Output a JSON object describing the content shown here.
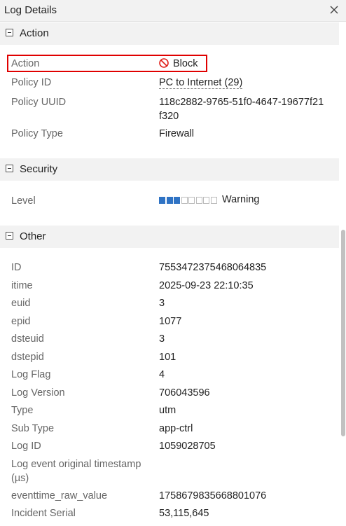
{
  "header": {
    "title": "Log Details"
  },
  "sections": {
    "action": {
      "label": "Action"
    },
    "security": {
      "label": "Security"
    },
    "other": {
      "label": "Other"
    }
  },
  "action_rows": {
    "action": {
      "label": "Action",
      "value": "Block",
      "icon": "block-icon",
      "icon_color": "#e0201a"
    },
    "policy_id": {
      "label": "Policy ID",
      "value": "PC to Internet (29)"
    },
    "policy_uuid": {
      "label": "Policy UUID",
      "value_line1": "118c2882-9765-51f0-4647-19677f21",
      "value_line2": "f320"
    },
    "policy_type": {
      "label": "Policy Type",
      "value": "Firewall"
    }
  },
  "security_rows": {
    "level": {
      "label": "Level",
      "value": "Warning",
      "filled_segments": 3,
      "total_segments": 8,
      "fill_color": "#2f73c4"
    }
  },
  "other_rows": [
    {
      "label": "ID",
      "value": "7553472375468064835"
    },
    {
      "label": "itime",
      "value": "2025-09-23 22:10:35"
    },
    {
      "label": "euid",
      "value": "3"
    },
    {
      "label": "epid",
      "value": "1077"
    },
    {
      "label": "dsteuid",
      "value": "3"
    },
    {
      "label": "dstepid",
      "value": "101"
    },
    {
      "label": "Log Flag",
      "value": "4"
    },
    {
      "label": "Log Version",
      "value": "706043596"
    },
    {
      "label": "Type",
      "value": "utm"
    },
    {
      "label": "Sub Type",
      "value": "app-ctrl"
    },
    {
      "label": "Log ID",
      "value": "1059028705"
    },
    {
      "label_line1": "Log event original timestamp",
      "label_line2": "(µs)",
      "value": ""
    },
    {
      "label": "eventtime_raw_value",
      "value": "1758679835668801076"
    },
    {
      "label": "Incident Serial",
      "value": "53,115,645"
    }
  ]
}
